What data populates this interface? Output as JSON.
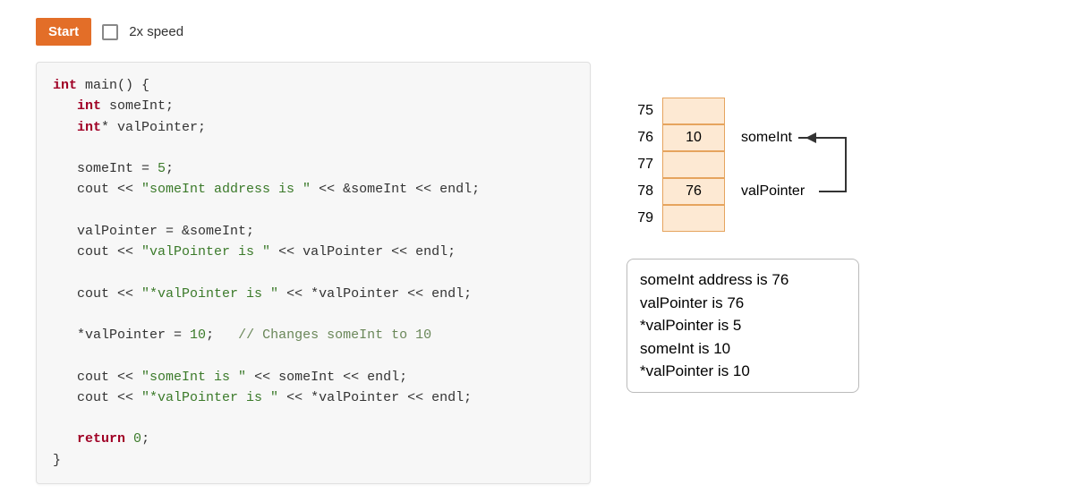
{
  "controls": {
    "start_label": "Start",
    "speed_label": "2x speed",
    "speed_checked": false
  },
  "code": {
    "line1_a": "int",
    "line1_b": " main() {",
    "line2_a": "int",
    "line2_b": " someInt;",
    "line3_a": "int",
    "line3_b": "* valPointer;",
    "line5": "someInt = ",
    "line5_lit": "5",
    "line5_end": ";",
    "line6_a": "cout << ",
    "line6_str": "\"someInt address is \"",
    "line6_b": " << &someInt << endl;",
    "line8": "valPointer = &someInt;",
    "line9_a": "cout << ",
    "line9_str": "\"valPointer is \"",
    "line9_b": " << valPointer << endl;",
    "line11_a": "cout << ",
    "line11_str": "\"*valPointer is \"",
    "line11_b": " << *valPointer << endl;",
    "line13_a": "*valPointer = ",
    "line13_lit": "10",
    "line13_b": ";   ",
    "line13_cmt": "// Changes someInt to 10",
    "line15_a": "cout << ",
    "line15_str": "\"someInt is \"",
    "line15_b": " << someInt << endl;",
    "line16_a": "cout << ",
    "line16_str": "\"*valPointer is \"",
    "line16_b": " << *valPointer << endl;",
    "line18_a": "return",
    "line18_b": " ",
    "line18_lit": "0",
    "line18_end": ";",
    "line19": "}"
  },
  "memory": {
    "rows": [
      {
        "addr": "75",
        "val": "",
        "label": ""
      },
      {
        "addr": "76",
        "val": "10",
        "label": "someInt"
      },
      {
        "addr": "77",
        "val": "",
        "label": ""
      },
      {
        "addr": "78",
        "val": "76",
        "label": "valPointer"
      },
      {
        "addr": "79",
        "val": "",
        "label": ""
      }
    ]
  },
  "output": {
    "lines": [
      "someInt address is 76",
      "valPointer is 76",
      "*valPointer is 5",
      "someInt is 10",
      "*valPointer is 10"
    ]
  }
}
